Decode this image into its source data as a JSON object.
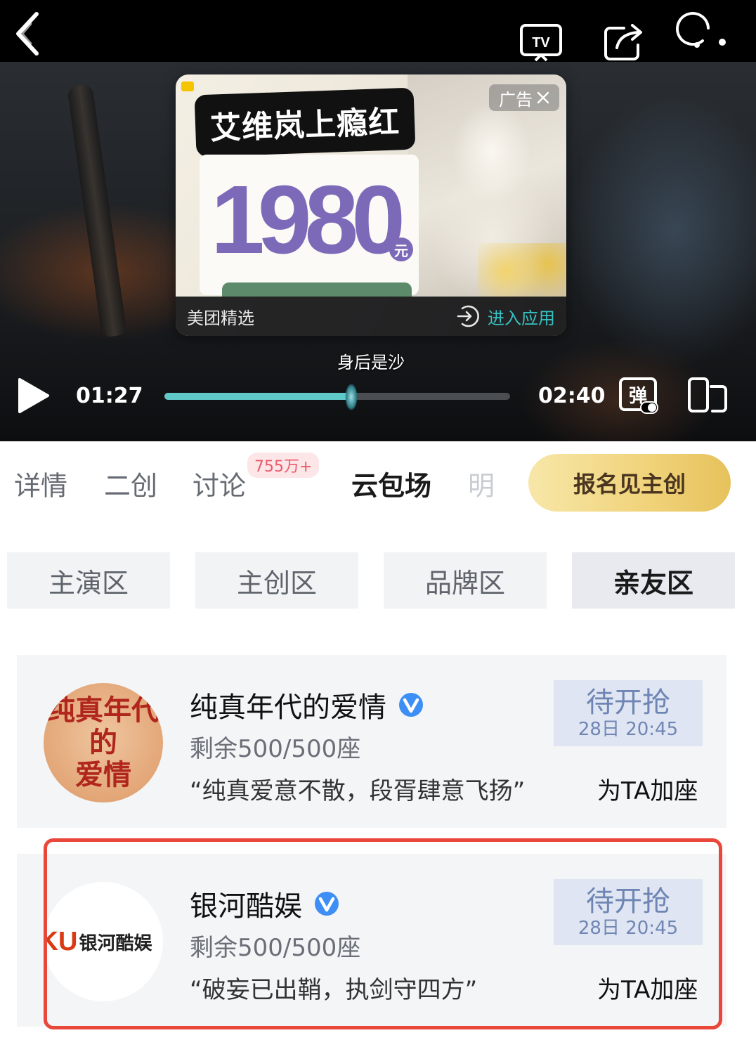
{
  "player": {
    "ad": {
      "headline": "艾维岚上瘾红",
      "price": "1980",
      "price_unit": "元",
      "ad_label": "广告",
      "brand": "美团精选",
      "enter_app": "进入应用"
    },
    "subtitle": "身后是沙",
    "current_time": "01:27",
    "total_time": "02:40",
    "progress_fraction": 0.54,
    "danmaku_label": "弹",
    "accent_color": "#5fc9c9"
  },
  "tabs": {
    "items": [
      {
        "label": "详情"
      },
      {
        "label": "二创"
      },
      {
        "label": "讨论"
      },
      {
        "label": "云包场"
      },
      {
        "label": "明"
      }
    ],
    "active_index": 3,
    "discussion_badge": "755万+",
    "signup_button": "报名见主创"
  },
  "zones": {
    "items": [
      {
        "label": "主演区"
      },
      {
        "label": "主创区"
      },
      {
        "label": "品牌区"
      },
      {
        "label": "亲友区"
      }
    ],
    "active_index": 3
  },
  "cards": [
    {
      "avatar_text_line1": "纯真年代的",
      "avatar_text_line2": "爱情",
      "title": "纯真年代的爱情",
      "seats": "剩余500/500座",
      "quote": "“纯真爱意不散，段胥肆意飞扬”",
      "grab_status": "待开抢",
      "grab_time": "28日 20:45",
      "add_seat": "为TA加座"
    },
    {
      "avatar_logo_ku": "KU",
      "avatar_logo_name": "银河酷娱",
      "title": "银河酷娱",
      "seats": "剩余500/500座",
      "quote": "“破妄已出鞘，执剑守四方”",
      "grab_status": "待开抢",
      "grab_time": "28日 20:45",
      "add_seat": "为TA加座"
    }
  ]
}
